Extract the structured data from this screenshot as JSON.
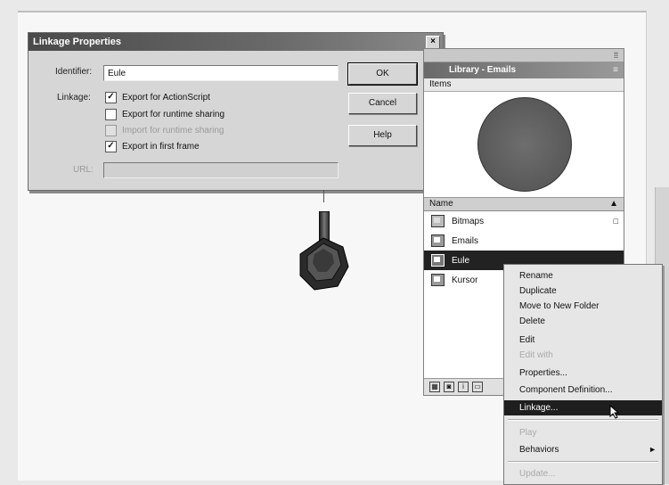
{
  "dialog": {
    "title": "Linkage Properties",
    "close_glyph": "×",
    "identifier_label": "Identifier:",
    "identifier_value": "Eule",
    "linkage_label": "Linkage:",
    "options": [
      {
        "label": "Export for ActionScript",
        "checked": "✓",
        "disabled": false
      },
      {
        "label": "Export for runtime sharing",
        "checked": "",
        "disabled": false
      },
      {
        "label": "Import for runtime sharing",
        "checked": "",
        "disabled": true
      },
      {
        "label": "Export in first frame",
        "checked": "✓",
        "disabled": false
      }
    ],
    "url_label": "URL:",
    "url_value": "",
    "ok_label": "OK",
    "cancel_label": "Cancel",
    "help_label": "Help"
  },
  "library": {
    "title": "Library - Emails",
    "subheader": "Items",
    "column_name": "Name",
    "sort_glyph": "▲",
    "options_glyph": "≡",
    "items": [
      {
        "name": "Bitmaps",
        "type": "folder"
      },
      {
        "name": "Emails",
        "type": "symbol"
      },
      {
        "name": "Eule",
        "type": "symbol",
        "selected": true
      },
      {
        "name": "Kursor",
        "type": "symbol"
      }
    ],
    "bottom_icons": [
      "▦",
      "◙",
      "i",
      "▭"
    ]
  },
  "context_menu": {
    "items": [
      {
        "label": "Rename",
        "disabled": false
      },
      {
        "label": "Duplicate",
        "disabled": false
      },
      {
        "label": "Move to New Folder",
        "disabled": false
      },
      {
        "label": "Delete",
        "disabled": false
      },
      {
        "label": "Edit",
        "disabled": false
      },
      {
        "label": "Edit with",
        "disabled": true
      },
      {
        "label": "Properties...",
        "disabled": false
      },
      {
        "label": "Component Definition...",
        "disabled": false
      },
      {
        "label": "Linkage...",
        "disabled": false,
        "highlighted": true
      },
      {
        "label": "Play",
        "disabled": true
      },
      {
        "label": "Behaviors",
        "disabled": false,
        "submenu": true
      },
      {
        "label": "Update...",
        "disabled": true
      }
    ],
    "submenu_arrow": "►"
  },
  "colors": {
    "dialog_title_bg": "#4a4a4a",
    "selection_bg": "#1e1e1e",
    "preview_circle": "#5a5a5a"
  }
}
